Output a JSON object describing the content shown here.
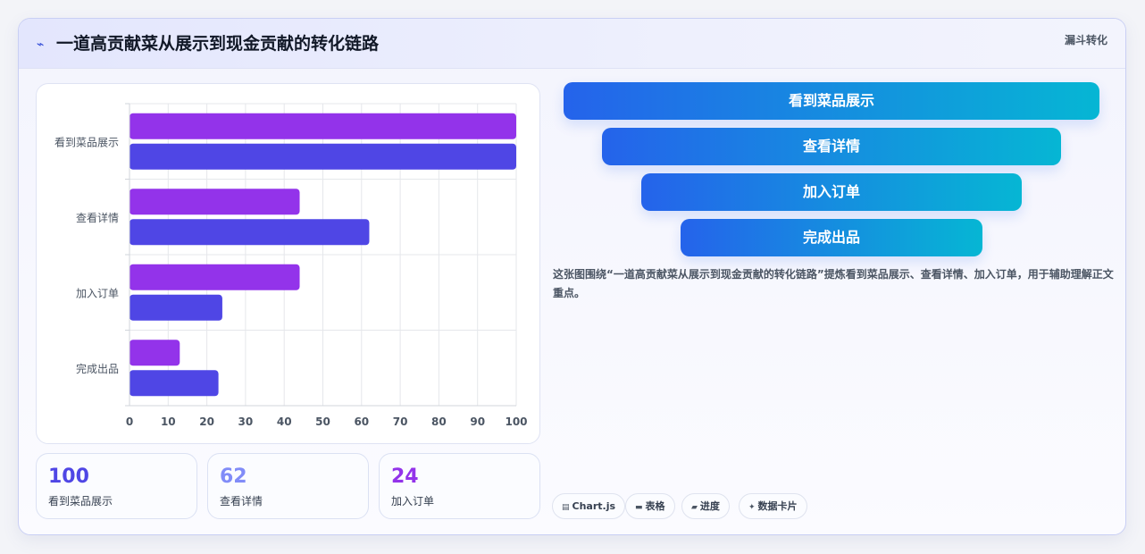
{
  "header": {
    "icon": "zigzag-icon",
    "title": "一道高贡献菜从展示到现金贡献的转化链路",
    "tag": "漏斗转化"
  },
  "chart_data": {
    "type": "bar",
    "orientation": "horizontal",
    "categories": [
      "看到菜品展示",
      "查看详情",
      "加入订单",
      "完成出品"
    ],
    "series": [
      {
        "values": [
          100,
          44,
          44,
          13
        ],
        "color": "#9333ea"
      },
      {
        "values": [
          100,
          62,
          24,
          23
        ],
        "color": "#4f46e5"
      }
    ],
    "xlim": [
      0,
      100
    ],
    "xticks": [
      0,
      10,
      20,
      30,
      40,
      50,
      60,
      70,
      80,
      90,
      100
    ],
    "grid": true
  },
  "stats": [
    {
      "value": "100",
      "label": "看到菜品展示",
      "color": "#4f46e5"
    },
    {
      "value": "62",
      "label": "查看详情",
      "color": "#818cf8"
    },
    {
      "value": "24",
      "label": "加入订单",
      "color": "#9333ea"
    }
  ],
  "funnel": [
    "看到菜品展示",
    "查看详情",
    "加入订单",
    "完成出品"
  ],
  "description": "这张图围绕“一道高贡献菜从展示到现金贡献的转化链路”提炼看到菜品展示、查看详情、加入订单，用于辅助理解正文重点。",
  "pills": [
    {
      "icon": "chart-icon",
      "glyph": "▤",
      "label": "Chart.js"
    },
    {
      "icon": "table-icon",
      "glyph": "▬",
      "label": "表格"
    },
    {
      "icon": "progress-icon",
      "glyph": "▰",
      "label": "进度"
    },
    {
      "icon": "sparkle-icon",
      "glyph": "✦",
      "label": "数据卡片"
    }
  ]
}
